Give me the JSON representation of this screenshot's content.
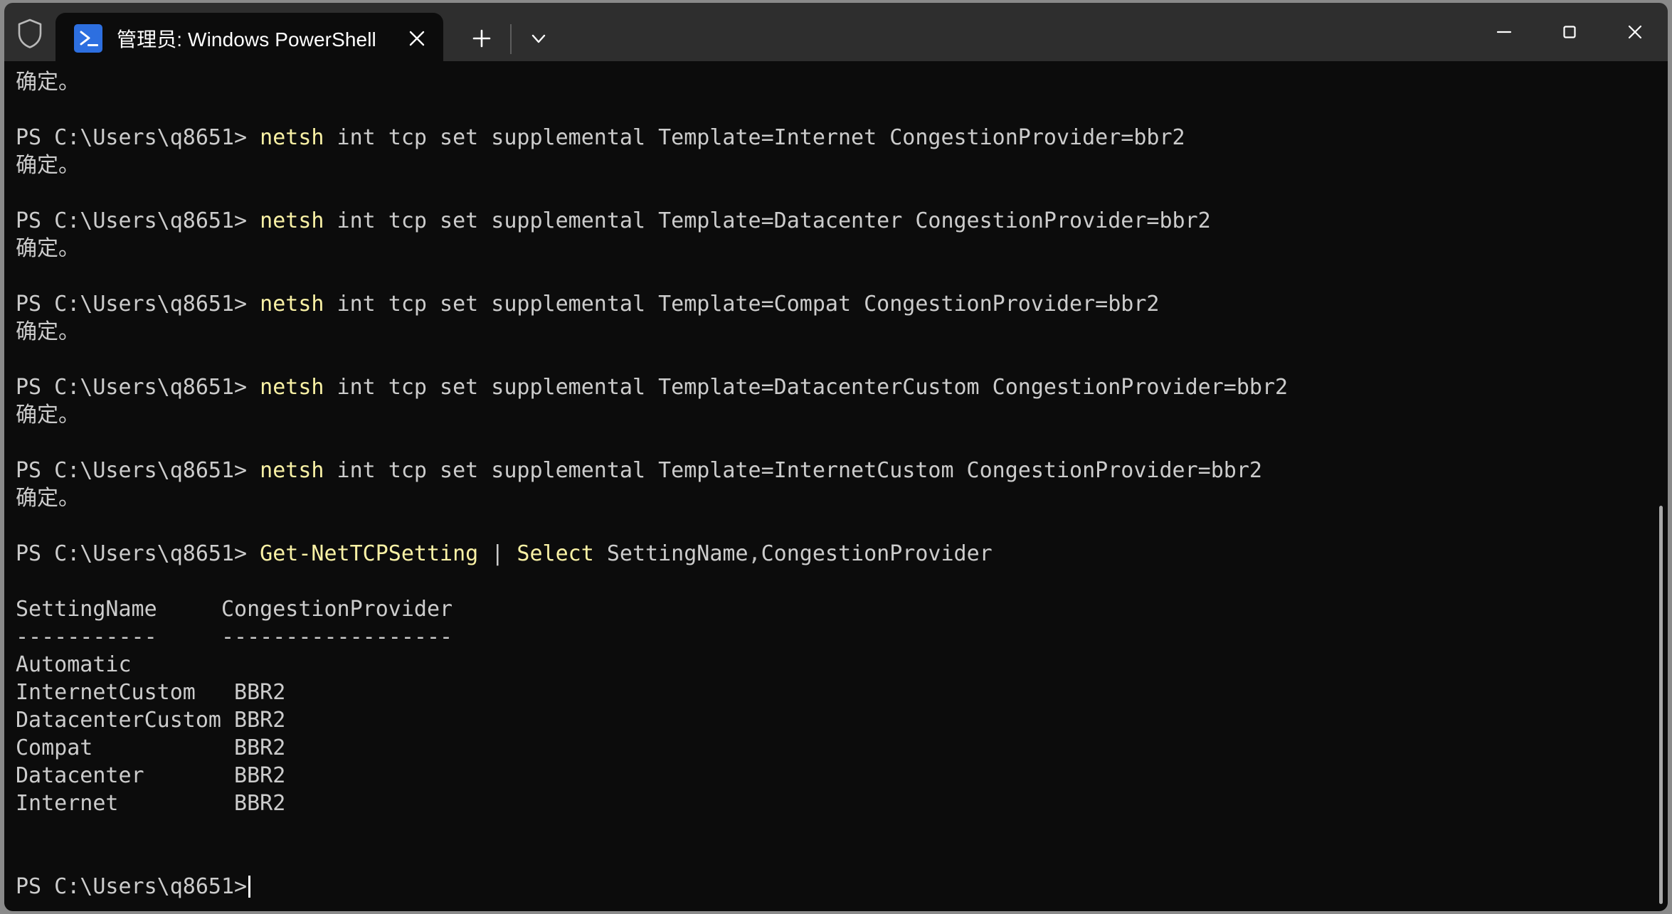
{
  "window": {
    "shield_icon": "shield-icon",
    "tab": {
      "icon": "powershell-logo-icon",
      "title": "管理员: Windows PowerShell",
      "close_label": "✕"
    },
    "new_tab_label": "+",
    "dropdown_label": "⌄",
    "controls": {
      "minimize": "—",
      "maximize": "□",
      "close": "✕"
    }
  },
  "terminal": {
    "prompt": "PS C:\\Users\\q8651>",
    "ok_text": "确定。",
    "colors": {
      "background": "#0c0c0c",
      "foreground": "#cccccc",
      "command": "#f9f1a5",
      "titlebar": "#2e2e2e",
      "accent": "#2d6fe0"
    },
    "lines": [
      {
        "type": "output",
        "text": "确定。"
      },
      {
        "type": "blank",
        "text": ""
      },
      {
        "type": "command",
        "prompt": "PS C:\\Users\\q8651>",
        "cmd": "netsh",
        "args": " int tcp set supplemental Template=Internet CongestionProvider=bbr2"
      },
      {
        "type": "output",
        "text": "确定。"
      },
      {
        "type": "blank",
        "text": ""
      },
      {
        "type": "command",
        "prompt": "PS C:\\Users\\q8651>",
        "cmd": "netsh",
        "args": " int tcp set supplemental Template=Datacenter CongestionProvider=bbr2"
      },
      {
        "type": "output",
        "text": "确定。"
      },
      {
        "type": "blank",
        "text": ""
      },
      {
        "type": "command",
        "prompt": "PS C:\\Users\\q8651>",
        "cmd": "netsh",
        "args": " int tcp set supplemental Template=Compat CongestionProvider=bbr2"
      },
      {
        "type": "output",
        "text": "确定。"
      },
      {
        "type": "blank",
        "text": ""
      },
      {
        "type": "command",
        "prompt": "PS C:\\Users\\q8651>",
        "cmd": "netsh",
        "args": " int tcp set supplemental Template=DatacenterCustom CongestionProvider=bbr2"
      },
      {
        "type": "output",
        "text": "确定。"
      },
      {
        "type": "blank",
        "text": ""
      },
      {
        "type": "command",
        "prompt": "PS C:\\Users\\q8651>",
        "cmd": "netsh",
        "args": " int tcp set supplemental Template=InternetCustom CongestionProvider=bbr2"
      },
      {
        "type": "output",
        "text": "确定。"
      },
      {
        "type": "blank",
        "text": ""
      }
    ],
    "pipeline_command": {
      "prompt": "PS C:\\Users\\q8651>",
      "cmd": "Get-NetTCPSetting",
      "pipe": " | ",
      "cmd2": "Select",
      "params": " SettingName",
      "comma": ",",
      "params2": "CongestionProvider"
    },
    "table": {
      "headers": [
        "SettingName",
        "CongestionProvider"
      ],
      "separators": [
        "-----------",
        "------------------"
      ],
      "header_line": "SettingName     CongestionProvider",
      "separator_line": "-----------     ------------------",
      "rows": [
        {
          "name": "Automatic",
          "provider": "",
          "line": "Automatic"
        },
        {
          "name": "InternetCustom",
          "provider": "BBR2",
          "line": "InternetCustom   BBR2"
        },
        {
          "name": "DatacenterCustom",
          "provider": "BBR2",
          "line": "DatacenterCustom BBR2"
        },
        {
          "name": "Compat",
          "provider": "BBR2",
          "line": "Compat           BBR2"
        },
        {
          "name": "Datacenter",
          "provider": "BBR2",
          "line": "Datacenter       BBR2"
        },
        {
          "name": "Internet",
          "provider": "BBR2",
          "line": "Internet         BBR2"
        }
      ]
    },
    "final_prompt": "PS C:\\Users\\q8651>"
  }
}
